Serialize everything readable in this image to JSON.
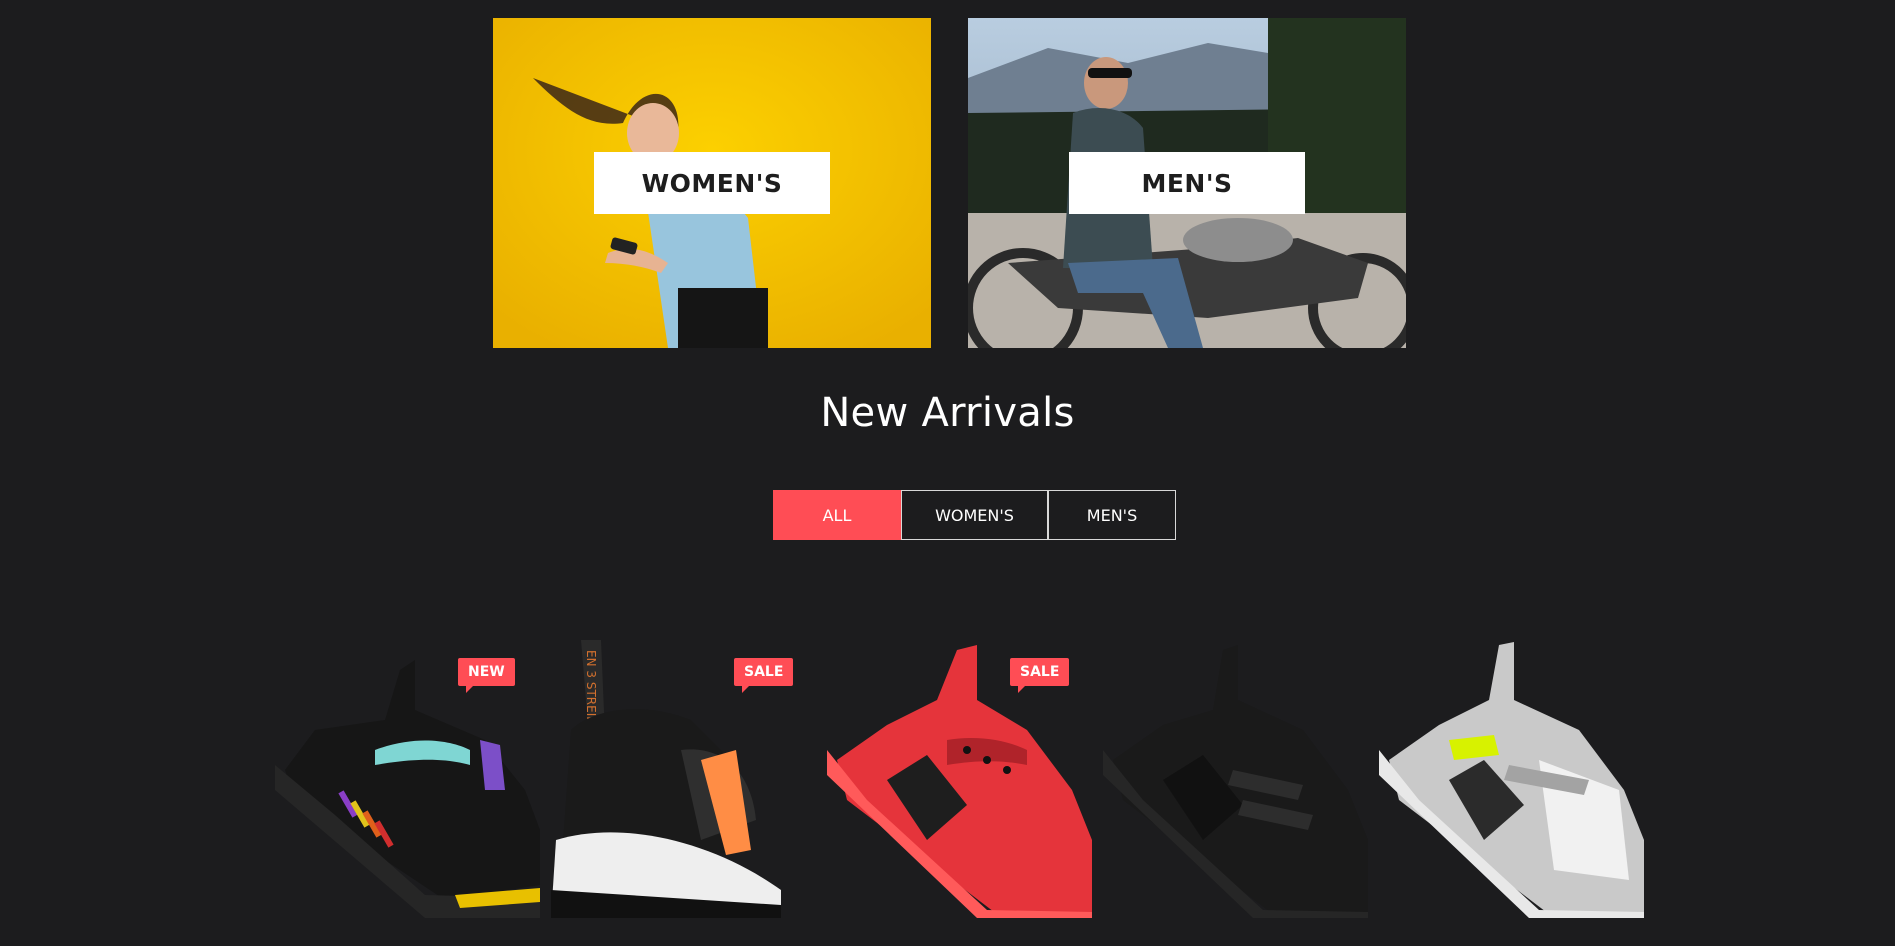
{
  "categories": {
    "womens_label": "WOMEN'S",
    "mens_label": "MEN'S"
  },
  "new_arrivals": {
    "title": "New Arrivals",
    "filters": {
      "all": "ALL",
      "womens": "WOMEN'S",
      "mens": "MEN'S",
      "active": "ALL"
    }
  },
  "products": [
    {
      "badge": "NEW",
      "colorway": "black-multicolor"
    },
    {
      "badge": "SALE",
      "colorway": "black-orange"
    },
    {
      "badge": "SALE",
      "colorway": "red"
    },
    {
      "badge": "",
      "colorway": "black"
    },
    {
      "badge": "",
      "colorway": "white-volt"
    }
  ],
  "colors": {
    "background": "#1c1c1e",
    "accent": "#ff4d55",
    "womens_banner": "#f2b800"
  }
}
